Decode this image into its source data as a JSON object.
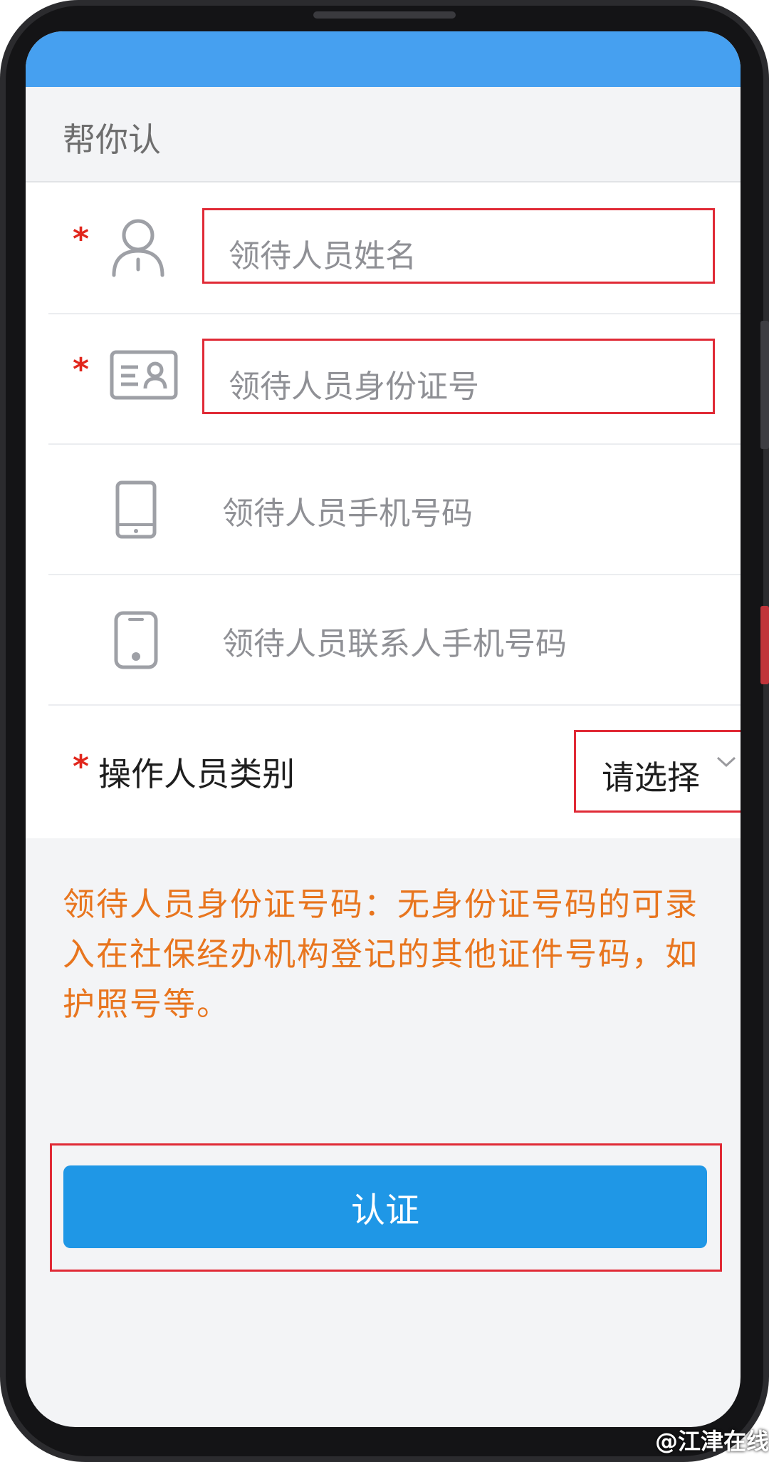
{
  "header": {
    "title": "帮你认"
  },
  "form": {
    "required_mark": "*",
    "name_field": {
      "placeholder": "领待人员姓名",
      "icon": "user-icon",
      "required": true
    },
    "id_field": {
      "placeholder": "领待人员身份证号",
      "icon": "id-card-icon",
      "required": true
    },
    "phone_field": {
      "placeholder": "领待人员手机号码",
      "icon": "phone-icon",
      "required": false
    },
    "contact_phone_field": {
      "placeholder": "领待人员联系人手机号码",
      "icon": "phone-icon",
      "required": false
    },
    "operator_type": {
      "label": "操作人员类别",
      "selected": "请选择",
      "required": true
    }
  },
  "note": "领待人员身份证号码：无身份证号码的可录入在社保经办机构登记的其他证件号码，如护照号等。",
  "submit_button": {
    "label": "认证"
  },
  "watermark": "@江津在线",
  "colors": {
    "status_bar": "#46a0f0",
    "required": "#e1261c",
    "highlight_border": "#e02a36",
    "note_text": "#e8751e",
    "button": "#1f97e6"
  }
}
